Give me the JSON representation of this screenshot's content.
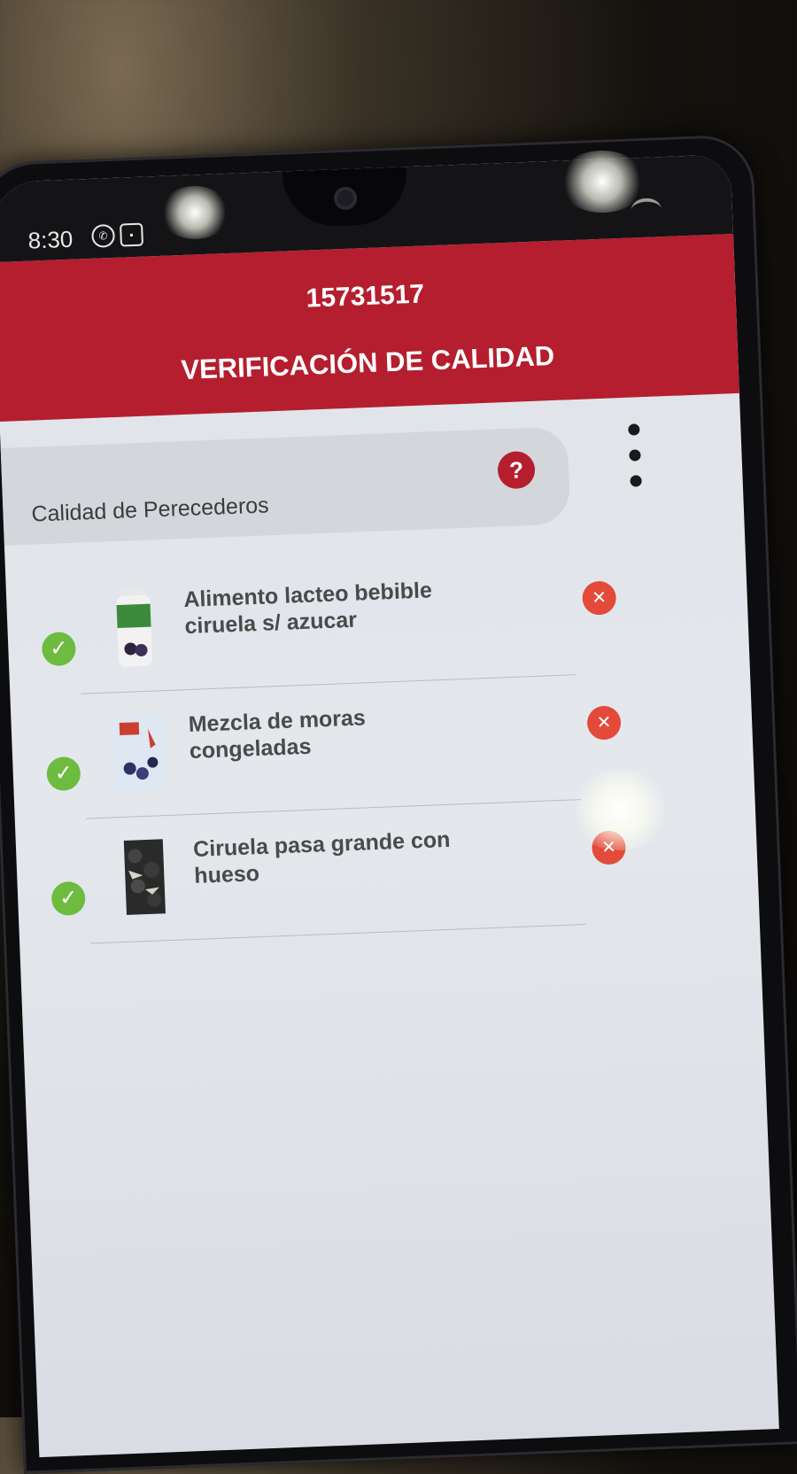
{
  "status_bar": {
    "time": "8:30",
    "icons": [
      "whatsapp-icon",
      "notification-icon",
      "wifi-icon"
    ]
  },
  "header": {
    "order_number": "15731517",
    "title": "VERIFICACIÓN DE CALIDAD"
  },
  "section": {
    "label": "Calidad de Perecederos",
    "help_glyph": "?"
  },
  "items": [
    {
      "name": "Alimento lacteo bebible ciruela s/ azucar",
      "checked": true,
      "thumbnail": "yogurt-bottle"
    },
    {
      "name": "Mezcla de moras congeladas",
      "checked": true,
      "thumbnail": "frozen-berries-bag"
    },
    {
      "name": "Ciruela pasa grande con hueso",
      "checked": true,
      "thumbnail": "prunes-pack"
    }
  ],
  "icons": {
    "check_glyph": "✓",
    "remove_glyph": "✕"
  },
  "colors": {
    "header_red": "#b51e2e",
    "check_green": "#6dbb3f",
    "remove_red": "#e34a3a"
  }
}
